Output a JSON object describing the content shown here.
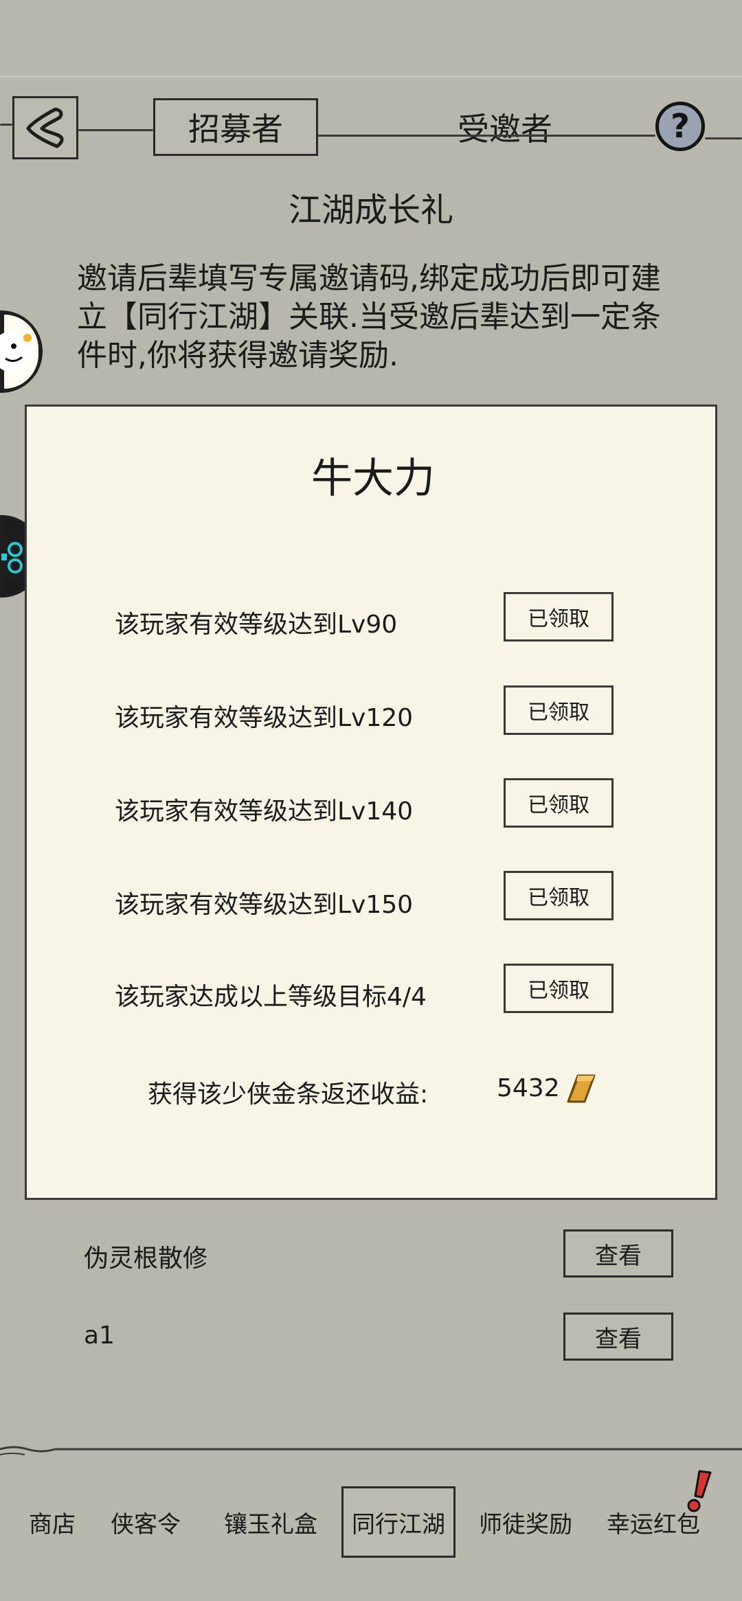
{
  "header": {
    "tabs": [
      {
        "label": "招募者",
        "active": true
      },
      {
        "label": "受邀者",
        "active": false
      }
    ],
    "help_label": "?"
  },
  "page": {
    "title": "江湖成长礼",
    "description": "邀请后辈填写专属邀请码,绑定成功后即可建立【同行江湖】关联.当受邀后辈达到一定条件时,你将获得邀请奖励."
  },
  "card": {
    "player_name": "牛大力",
    "rewards": [
      {
        "requirement": "该玩家有效等级达到Lv90",
        "button": "已领取"
      },
      {
        "requirement": "该玩家有效等级达到Lv120",
        "button": "已领取"
      },
      {
        "requirement": "该玩家有效等级达到Lv140",
        "button": "已领取"
      },
      {
        "requirement": "该玩家有效等级达到Lv150",
        "button": "已领取"
      },
      {
        "requirement": "该玩家达成以上等级目标4/4",
        "button": "已领取"
      }
    ],
    "earnings_label": "获得该少侠金条返还收益:",
    "earnings_value": "5432"
  },
  "invitees": [
    {
      "name": "伪灵根散修",
      "button": "查看"
    },
    {
      "name": "a1",
      "button": "查看"
    }
  ],
  "bottom_nav": [
    {
      "label": "商店",
      "active": false
    },
    {
      "label": "侠客令",
      "active": false
    },
    {
      "label": "镶玉礼盒",
      "active": false
    },
    {
      "label": "同行江湖",
      "active": true
    },
    {
      "label": "师徒奖励",
      "active": false
    },
    {
      "label": "幸运红包",
      "active": false
    }
  ],
  "colors": {
    "background": "#b9b6ab",
    "card": "#f8f4e6",
    "ink": "#1b1b1b",
    "help_icon": "#9aa3b1",
    "notice_badge": "#d7382e",
    "gold": "#e0a437"
  }
}
